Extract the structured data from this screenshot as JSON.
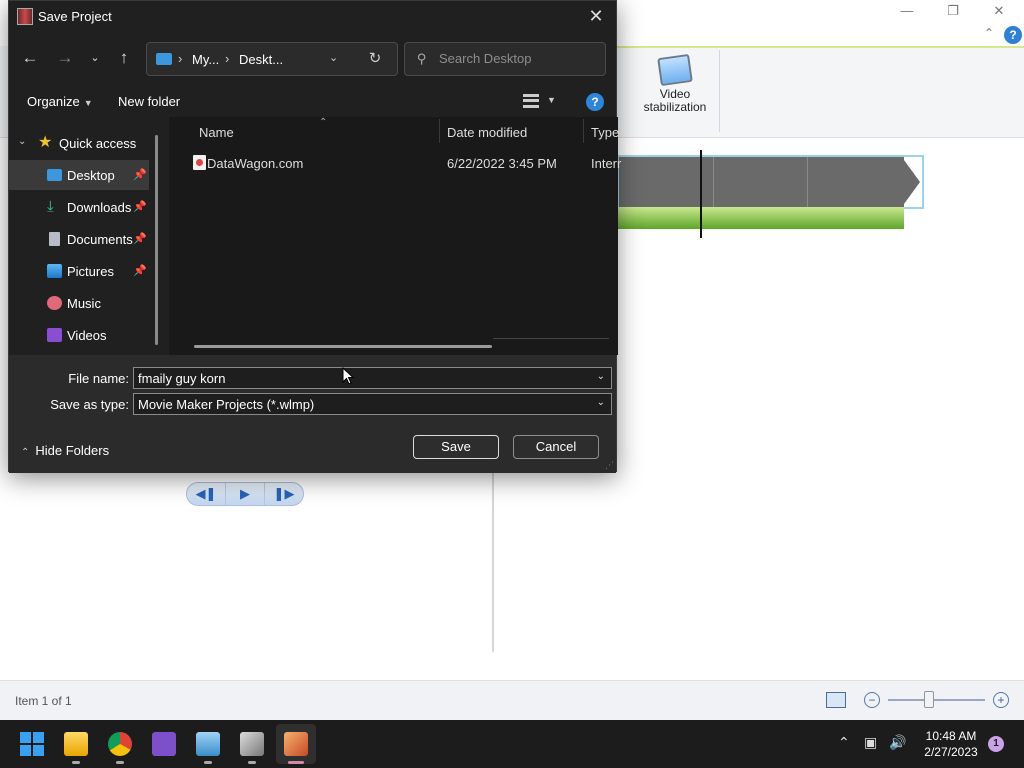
{
  "dialog": {
    "title": "Save Project",
    "address": {
      "segments": [
        "My...",
        "Deskt..."
      ]
    },
    "search": {
      "placeholder": "Search Desktop"
    },
    "toolbar": {
      "organize_label": "Organize",
      "new_folder_label": "New folder"
    },
    "nav_pane": {
      "quick_access_label": "Quick access",
      "items": [
        {
          "label": "Desktop",
          "icon": "desktop-icon",
          "pinned": true,
          "selected": true
        },
        {
          "label": "Downloads",
          "icon": "download-icon",
          "pinned": true
        },
        {
          "label": "Documents",
          "icon": "document-icon",
          "pinned": true
        },
        {
          "label": "Pictures",
          "icon": "picture-icon",
          "pinned": true
        },
        {
          "label": "Music",
          "icon": "music-icon",
          "pinned": false
        },
        {
          "label": "Videos",
          "icon": "video-icon",
          "pinned": false
        }
      ]
    },
    "file_list": {
      "columns": [
        "Name",
        "Date modified",
        "Type"
      ],
      "rows": [
        {
          "name": "DataWagon.com",
          "date_modified": "6/22/2022 3:45 PM",
          "type": "Interr"
        }
      ]
    },
    "file_name": {
      "label": "File name:",
      "value": "fmaily guy korn"
    },
    "save_as_type": {
      "label": "Save as type:",
      "value": "Movie Maker Projects (*.wlmp)"
    },
    "hide_folders_label": "Hide Folders",
    "save_label": "Save",
    "cancel_label": "Cancel",
    "accent_color": "#2f86d8"
  },
  "movie_maker": {
    "ribbon": {
      "video_stabilization_label": "Video stabilization"
    },
    "status_text": "Item 1 of 1",
    "zoom_level": 0.42
  },
  "taskbar": {
    "apps": [
      "start-icon",
      "file-explorer-icon",
      "chrome-icon",
      "visual-studio-icon",
      "remote-desktop-icon",
      "paint-icon",
      "movie-maker-icon"
    ],
    "time": "10:48 AM",
    "date": "2/27/2023",
    "notification_count": "1"
  }
}
